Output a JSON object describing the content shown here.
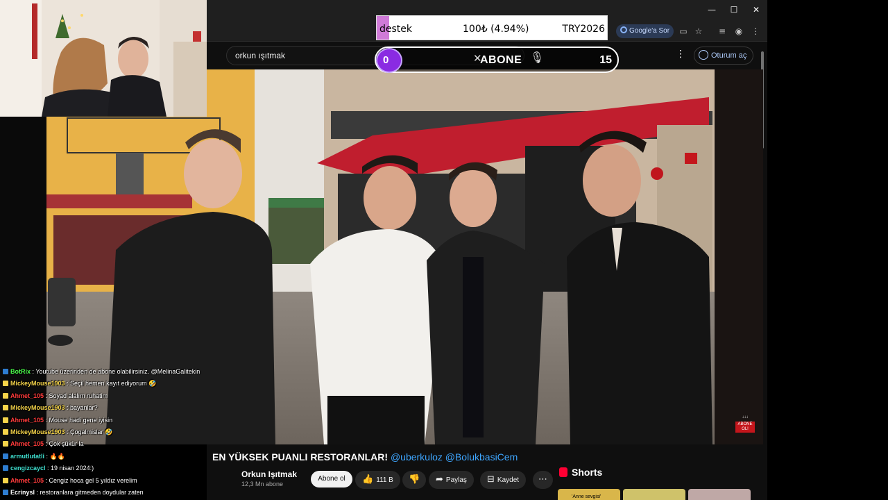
{
  "browser": {
    "window_controls": {
      "minimize": "—",
      "maximize": "☐",
      "close": "✕"
    },
    "google_ask": "Google'a Sor"
  },
  "youtube": {
    "search": {
      "value": "orkun ışıtmak"
    },
    "signin": "Oturum aç",
    "video_title": "EN YÜKSEK PUANLI RESTORANLAR!",
    "video_title_tags": "@uberkuloz @BolukbasiCem",
    "channel": {
      "name": "Orkun Işıtmak",
      "subscribers": "12,3 Mn abone"
    },
    "subscribe_label": "Abone ol",
    "actions": {
      "likes": "111 B",
      "share": "Paylaş",
      "save": "Kaydet"
    },
    "shorts_label": "Shorts",
    "shorts_thumb_caption": "'Anne sevgisi'"
  },
  "overlays": {
    "donation": {
      "label": "destek",
      "amount": "100₺ (4.94%)",
      "goal": "TRY2026",
      "progress_percent": 4.94,
      "color": "#d07bd8"
    },
    "subscriber_goal": {
      "current": "0",
      "label": "ABONE",
      "target": "15",
      "color": "#8a2be2"
    },
    "abone_badge": {
      "arrows": "↓↓↓",
      "label": "ABONE OL!"
    }
  },
  "chat": [
    {
      "user": "BotRix",
      "text": ": Youtube üzerinden de abone olabilirsiniz. @MelinaGalitekin",
      "color": "green"
    },
    {
      "user": "MickeyMouse1903",
      "text": ": Seçil hemen kayıt ediyorum 🤣",
      "color": "yellow"
    },
    {
      "user": "Ahmet_105",
      "text": ": Soyad alalım ruhatim",
      "color": "red"
    },
    {
      "user": "MickeyMouse1903",
      "text": ": bayanlar?",
      "color": "yellow"
    },
    {
      "user": "Ahmet_105",
      "text": ": Mouse hadi gene iyisin",
      "color": "red"
    },
    {
      "user": "MickeyMouse1903",
      "text": ": Çogalmislar 🤣",
      "color": "yellow"
    },
    {
      "user": "Ahmet_105",
      "text": ": Çok şükür la",
      "color": "red"
    },
    {
      "user": "armutlutatli",
      "text": ": 🔥🔥",
      "color": "cyan"
    },
    {
      "user": "cengizcaycl",
      "text": ": 19 nisan 2024:)",
      "color": "cyan"
    },
    {
      "user": "Ahmet_105",
      "text": ": Cengiz hoca gel 5 yıldız verelim",
      "color": "red"
    },
    {
      "user": "Ecrinysl",
      "text": ": restoranlara gitmeden doydular zaten",
      "color": "white"
    }
  ]
}
